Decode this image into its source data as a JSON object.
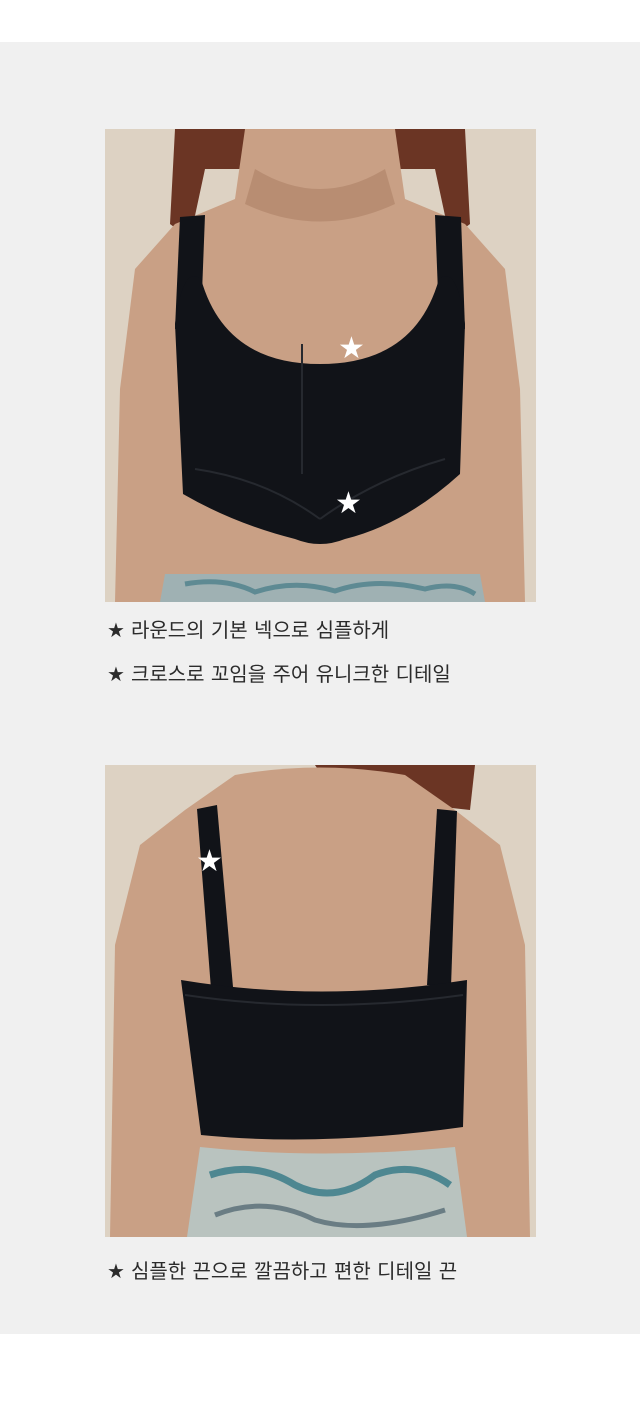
{
  "colors": {
    "page_bg": "#ffffff",
    "panel_bg": "#f0f0f0",
    "text": "#2b2b2b",
    "garment": "#111318",
    "star": "#ffffff"
  },
  "section_front": {
    "photo_icon": "front-view-photo",
    "marker_icon": "star-marker-icon",
    "captions": [
      {
        "bullet": "★",
        "text": "라운드의 기본 넥으로 심플하게"
      },
      {
        "bullet": "★",
        "text": "크로스로 꼬임을 주어 유니크한 디테일"
      }
    ]
  },
  "section_back": {
    "photo_icon": "back-view-photo",
    "marker_icon": "star-marker-icon",
    "captions": [
      {
        "bullet": "★",
        "text": "심플한 끈으로 깔끔하고 편한 디테일 끈"
      }
    ]
  }
}
